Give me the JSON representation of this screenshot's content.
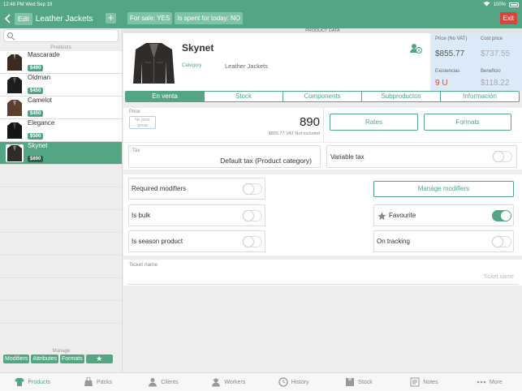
{
  "status_bar": {
    "time": "12:48 PM",
    "date": "Wed Sep 19",
    "battery": "100%"
  },
  "nav": {
    "edit_label": "Edit",
    "title": "Leather Jackets",
    "add_label": "+",
    "for_sale_label": "For sale: YES",
    "spent_today_label": "Is spent for today: NO",
    "exit_label": "Exit"
  },
  "sidebar": {
    "search_placeholder": "",
    "section_label": "Products",
    "items": [
      {
        "name": "Mascarade",
        "price": "$490",
        "active": false
      },
      {
        "name": "Oldman",
        "price": "$450",
        "active": false
      },
      {
        "name": "Camelot",
        "price": "$450",
        "active": false
      },
      {
        "name": "Elegance",
        "price": "$500",
        "active": false
      },
      {
        "name": "Skynet",
        "price": "$890",
        "active": true
      }
    ],
    "manage_label": "Manage",
    "manage_buttons": [
      "Modifiers",
      "Attributes",
      "Formats"
    ]
  },
  "product": {
    "section_title": "PRODUCT DATA",
    "name": "Skynet",
    "category_label": "Category",
    "category_value": "Leather Jackets"
  },
  "price_panel": {
    "price_no_vat_label": "Price (No VAT)",
    "price_no_vat_value": "$855.77",
    "cost_price_label": "Cost price",
    "cost_price_value": "$737.55",
    "stock_label": "Existencias",
    "stock_value": "9 U",
    "profit_label": "Beneficio",
    "profit_value": "$118.22"
  },
  "tabs": [
    {
      "label": "En venta",
      "active": true
    },
    {
      "label": "Stock",
      "active": false
    },
    {
      "label": "Components",
      "active": false
    },
    {
      "label": "Subproductos",
      "active": false
    },
    {
      "label": "Información",
      "active": false
    }
  ],
  "pricing": {
    "price_label": "Price",
    "no_price_group": "No price group",
    "price_value": "890",
    "vat_note": "$855.77 VAT Not included",
    "rates_label": "Rates",
    "formats_label": "Formats"
  },
  "tax": {
    "tax_label": "Tax",
    "tax_value": "Default tax (Product category)",
    "variable_tax_label": "Variable tax",
    "variable_tax_on": false
  },
  "modifiers": {
    "required_label": "Required modifiers",
    "required_on": false,
    "manage_label": "Manage modifiers",
    "bulk_label": "Is bulk",
    "bulk_on": false,
    "favourite_label": "Favourite",
    "favourite_on": true,
    "season_label": "Is season product",
    "season_on": false,
    "tracking_label": "On tracking",
    "tracking_on": false
  },
  "ticket": {
    "label": "Ticket name",
    "placeholder": "Ticket name"
  },
  "tabbar": [
    {
      "label": "Products",
      "icon": "shirt-icon",
      "active": true
    },
    {
      "label": "Packs",
      "icon": "bag-icon",
      "active": false
    },
    {
      "label": "Clients",
      "icon": "person-icon",
      "active": false
    },
    {
      "label": "Workers",
      "icon": "worker-icon",
      "active": false
    },
    {
      "label": "History",
      "icon": "clock-icon",
      "active": false
    },
    {
      "label": "Stock",
      "icon": "box-icon",
      "active": false
    },
    {
      "label": "Notes",
      "icon": "notes-icon",
      "active": false
    },
    {
      "label": "More",
      "icon": "more-dots-icon",
      "active": false
    }
  ],
  "colors": {
    "accent": "#54a584",
    "danger": "#d9453c",
    "panel_blue": "#dbeaf9"
  }
}
